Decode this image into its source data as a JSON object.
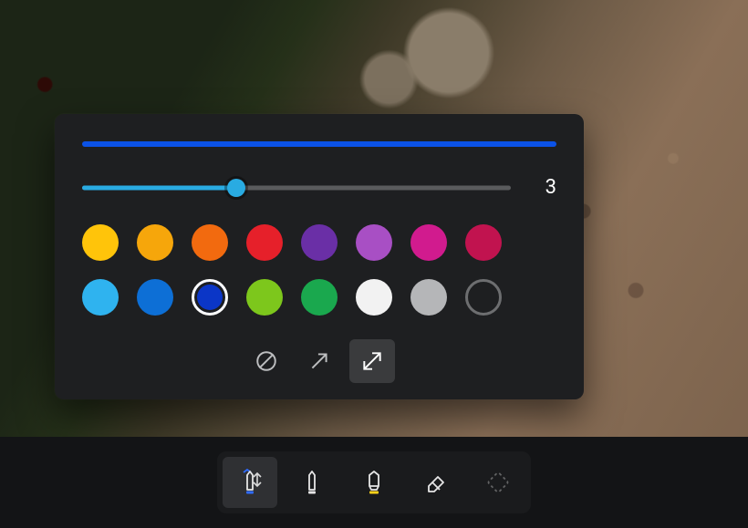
{
  "panel": {
    "preview_color": "#0b52e6",
    "thickness": {
      "value": 3,
      "min": 1,
      "max": 10,
      "percent": 36
    },
    "colors": [
      {
        "name": "yellow",
        "hex": "#ffc40a"
      },
      {
        "name": "amber",
        "hex": "#f6a60b"
      },
      {
        "name": "orange",
        "hex": "#f26a0f"
      },
      {
        "name": "red",
        "hex": "#e6202a"
      },
      {
        "name": "purple",
        "hex": "#6a2fa6"
      },
      {
        "name": "violet",
        "hex": "#a84fc4"
      },
      {
        "name": "magenta",
        "hex": "#d11b8e"
      },
      {
        "name": "crimson",
        "hex": "#c1134f"
      },
      {
        "name": "sky",
        "hex": "#2fb3ef"
      },
      {
        "name": "azure",
        "hex": "#0d6fd6"
      },
      {
        "name": "blue",
        "hex": "#0b36c7",
        "selected": true
      },
      {
        "name": "lime",
        "hex": "#7dc71c"
      },
      {
        "name": "green",
        "hex": "#1aa84e"
      },
      {
        "name": "white",
        "hex": "#f2f2f2"
      },
      {
        "name": "gray",
        "hex": "#b5b6b8"
      },
      {
        "name": "no-color",
        "outline": true
      }
    ],
    "tips": [
      {
        "name": "none",
        "active": false
      },
      {
        "name": "arrow-single",
        "active": false
      },
      {
        "name": "arrow-double",
        "active": true
      }
    ]
  },
  "toolbar": {
    "tools": [
      {
        "name": "pen",
        "active": true,
        "accent": "#2f6bff"
      },
      {
        "name": "pen-secondary",
        "active": false
      },
      {
        "name": "highlighter",
        "active": false,
        "accent": "#ffd21a"
      },
      {
        "name": "eraser",
        "active": false
      },
      {
        "name": "shape",
        "active": false,
        "dim": true
      }
    ]
  }
}
